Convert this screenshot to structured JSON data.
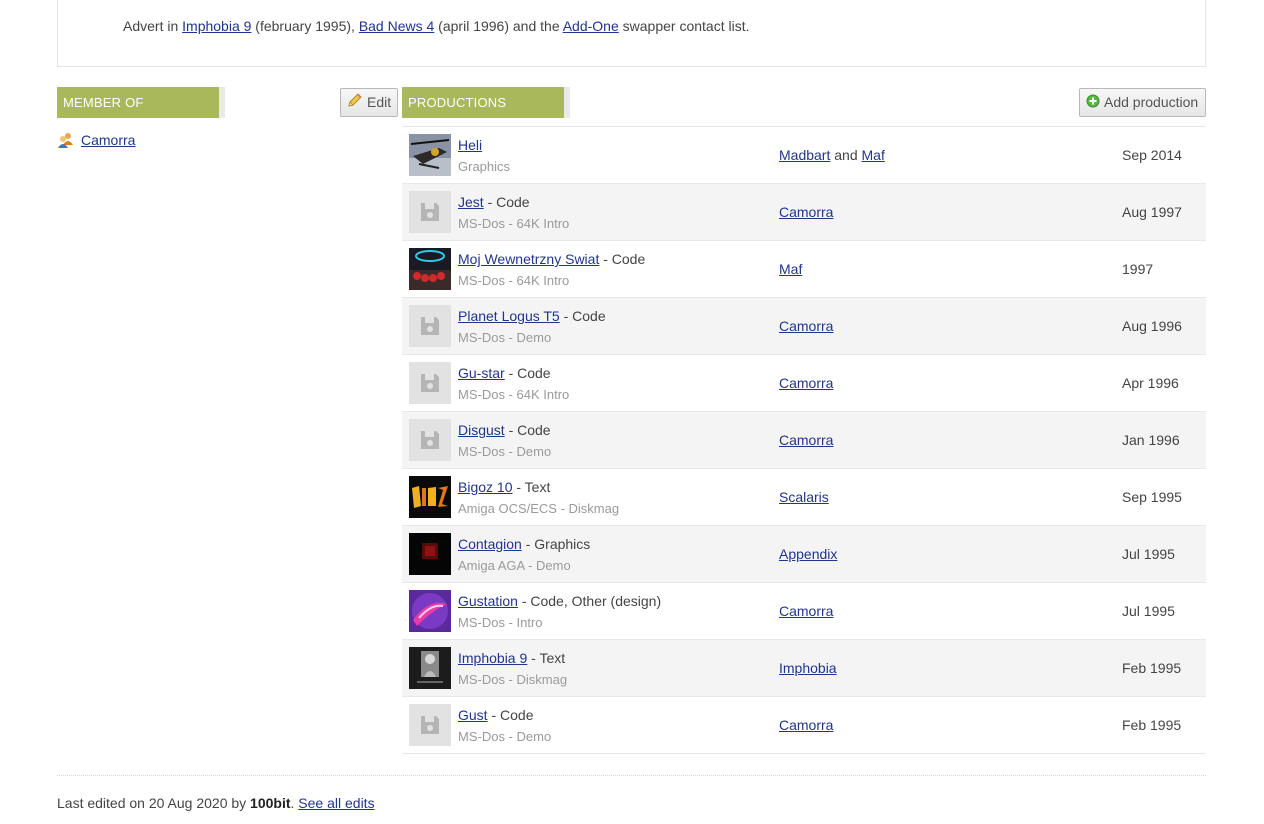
{
  "notes": {
    "prefix": "Advert in ",
    "link1": "Imphobia 9",
    "text1": " (february 1995), ",
    "link2": "Bad News 4",
    "text2": " (april 1996) and the ",
    "link3": "Add-One",
    "text3": " swapper contact list."
  },
  "member_of": {
    "title": "MEMBER OF",
    "edit_label": "Edit",
    "items": [
      {
        "label": "Camorra",
        "icon": "group-icon"
      }
    ]
  },
  "productions": {
    "title": "PRODUCTIONS",
    "add_label": "Add production",
    "rows": [
      {
        "title": "Heli",
        "role": "",
        "platform": "Graphics",
        "group1": "Madbart",
        "joiner": " and ",
        "group2": "Maf",
        "date": "Sep 2014",
        "thumb": "heli"
      },
      {
        "title": "Jest",
        "role": " - Code",
        "platform": "MS-Dos - 64K Intro",
        "group1": "Camorra",
        "joiner": "",
        "group2": "",
        "date": "Aug 1997",
        "thumb": "placeholder"
      },
      {
        "title": "Moj Wewnetrzny Swiat",
        "role": " - Code",
        "platform": "MS-Dos - 64K Intro",
        "group1": "Maf",
        "joiner": "",
        "group2": "",
        "date": "1997",
        "thumb": "moj"
      },
      {
        "title": "Planet Logus T5",
        "role": " - Code",
        "platform": "MS-Dos - Demo",
        "group1": "Camorra",
        "joiner": "",
        "group2": "",
        "date": "Aug 1996",
        "thumb": "placeholder"
      },
      {
        "title": "Gu-star",
        "role": " - Code",
        "platform": "MS-Dos - 64K Intro",
        "group1": "Camorra",
        "joiner": "",
        "group2": "",
        "date": "Apr 1996",
        "thumb": "placeholder"
      },
      {
        "title": "Disgust",
        "role": " - Code",
        "platform": "MS-Dos - Demo",
        "group1": "Camorra",
        "joiner": "",
        "group2": "",
        "date": "Jan 1996",
        "thumb": "placeholder"
      },
      {
        "title": "Bigoz 10",
        "role": " - Text",
        "platform": "Amiga OCS/ECS - Diskmag",
        "group1": "Scalaris",
        "joiner": "",
        "group2": "",
        "date": "Sep 1995",
        "thumb": "bigoz"
      },
      {
        "title": "Contagion",
        "role": " - Graphics",
        "platform": "Amiga AGA - Demo",
        "group1": "Appendix",
        "joiner": "",
        "group2": "",
        "date": "Jul 1995",
        "thumb": "contagion"
      },
      {
        "title": "Gustation",
        "role": " - Code, Other (design)",
        "platform": "MS-Dos - Intro",
        "group1": "Camorra",
        "joiner": "",
        "group2": "",
        "date": "Jul 1995",
        "thumb": "gustation"
      },
      {
        "title": "Imphobia 9",
        "role": " - Text",
        "platform": "MS-Dos - Diskmag",
        "group1": "Imphobia",
        "joiner": "",
        "group2": "",
        "date": "Feb 1995",
        "thumb": "imphobia"
      },
      {
        "title": "Gust",
        "role": " - Code",
        "platform": "MS-Dos - Demo",
        "group1": "Camorra",
        "joiner": "",
        "group2": "",
        "date": "Feb 1995",
        "thumb": "placeholder"
      }
    ]
  },
  "footer": {
    "prefix": "Last edited on 20 Aug 2020 by ",
    "user": "100bit",
    "sep": ". ",
    "link": "See all edits"
  },
  "colors": {
    "header_bg": "#a8b85a",
    "link": "#20358c",
    "alt_row": "#f4f4f4"
  }
}
